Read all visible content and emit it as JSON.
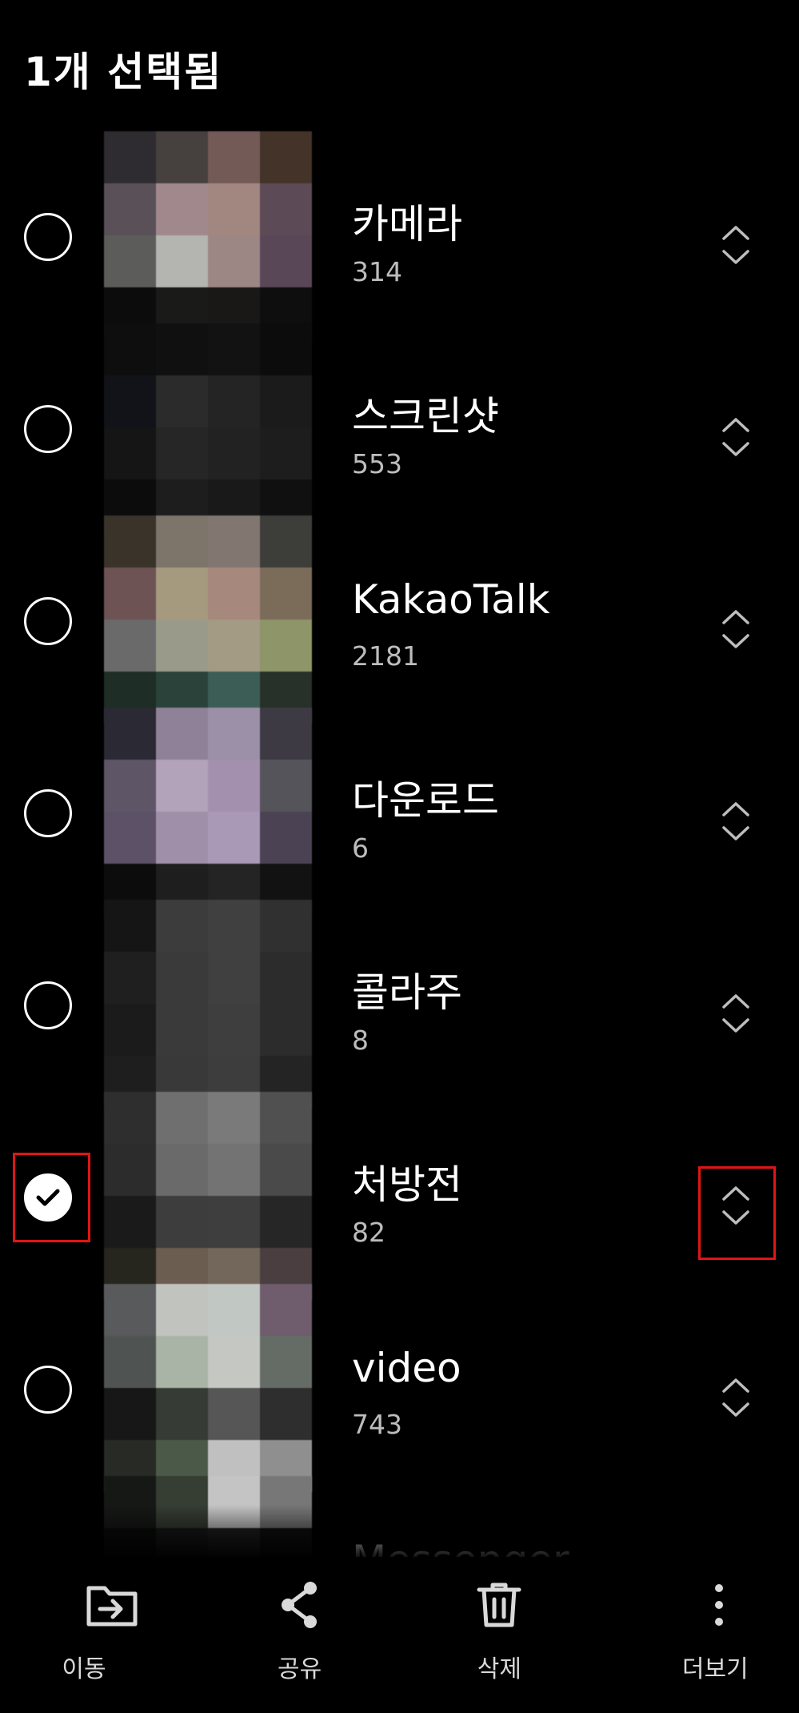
{
  "header": {
    "title": "1개 선택됨"
  },
  "albums": [
    {
      "name": "카메라",
      "count": "314",
      "selected": false,
      "thumb": [
        "#2e2c30",
        "#46403e",
        "#735a56",
        "#433328",
        "#5a5058",
        "#a1888c",
        "#a1877f",
        "#5c4a57",
        "#5c5d5b",
        "#b4b4b1",
        "#9c8784",
        "#594656",
        "#0c0c0c",
        "#1a1a19",
        "#191817",
        "#0e0e0e"
      ]
    },
    {
      "name": "스크린샷",
      "count": "553",
      "selected": false,
      "thumb": [
        "#0e0e0e",
        "#101010",
        "#121212",
        "#0c0c0c",
        "#121318",
        "#2b2b2b",
        "#242424",
        "#1b1b1b",
        "#151515",
        "#262626",
        "#222222",
        "#1d1d1d",
        "#0c0c0c",
        "#1d1d1d",
        "#191919",
        "#101010"
      ]
    },
    {
      "name": "KakaoTalk",
      "count": "2181",
      "selected": false,
      "thumb": [
        "#3a332a",
        "#7d746a",
        "#827671",
        "#3d3e3a",
        "#6d5353",
        "#a69a7e",
        "#a6897c",
        "#7b6c5a",
        "#6a6a6a",
        "#9a9a8b",
        "#a39b83",
        "#8d9569",
        "#1e2d26",
        "#2a423a",
        "#3b5d56",
        "#273029"
      ]
    },
    {
      "name": "다운로드",
      "count": "6",
      "selected": false,
      "thumb": [
        "#2b2933",
        "#8f8298",
        "#9b90a8",
        "#3d3a44",
        "#5e5666",
        "#b2a2ba",
        "#a390ae",
        "#55545b",
        "#5d5168",
        "#a08fa8",
        "#aa98b7",
        "#4b4354",
        "#0c0c0c",
        "#1e1e1e",
        "#242424",
        "#121212"
      ]
    },
    {
      "name": "콜라주",
      "count": "8",
      "selected": false,
      "thumb": [
        "#151515",
        "#3c3c3c",
        "#404040",
        "#303030",
        "#1f1f1f",
        "#3a3a3a",
        "#404040",
        "#2c2c2c",
        "#1b1b1b",
        "#3a3a3a",
        "#3e3e3e",
        "#2c2c2c",
        "#1e1e1e",
        "#393939",
        "#3d3d3d",
        "#242424"
      ]
    },
    {
      "name": "처방전",
      "count": "82",
      "selected": true,
      "thumb": [
        "#2e2e2e",
        "#6f6f6f",
        "#7a7a7a",
        "#505050",
        "#2c2c2c",
        "#6a6a6a",
        "#737373",
        "#4a4a4a",
        "#1a1a1a",
        "#3d3d3d",
        "#3e3e3e",
        "#262626",
        "#26251e",
        "#6b5d50",
        "#72675a",
        "#4a3e40"
      ]
    },
    {
      "name": "video",
      "count": "743",
      "selected": false,
      "thumb": [
        "#585a5b",
        "#c1c3bf",
        "#c1c7c3",
        "#6f5c6c",
        "#4f5452",
        "#a9b4a6",
        "#c5c8c2",
        "#656c66",
        "#161716",
        "#363b35",
        "#555655",
        "#2d2e2d",
        "#272a25",
        "#4b5a48",
        "#c0c0c0",
        "#8f8f8f"
      ]
    },
    {
      "name": "Messenger",
      "count": "",
      "selected": false,
      "thumb": [
        "#161816",
        "#363d33",
        "#c4c4c4",
        "#777777",
        "#0c0c0c",
        "#1a1a1a",
        "#222222",
        "#111111",
        "#000000",
        "#000000",
        "#000000",
        "#000000",
        "#000000",
        "#000000",
        "#000000",
        "#000000"
      ]
    }
  ],
  "bottom_bar": {
    "items": [
      {
        "label": "이동",
        "icon": "move-folder-icon"
      },
      {
        "label": "공유",
        "icon": "share-icon"
      },
      {
        "label": "삭제",
        "icon": "trash-icon"
      },
      {
        "label": "더보기",
        "icon": "more-vertical-icon"
      }
    ]
  },
  "colors": {
    "highlight": "#e01515",
    "background": "#000000",
    "text": "#ffffff",
    "subtext": "#bdbdbd"
  }
}
